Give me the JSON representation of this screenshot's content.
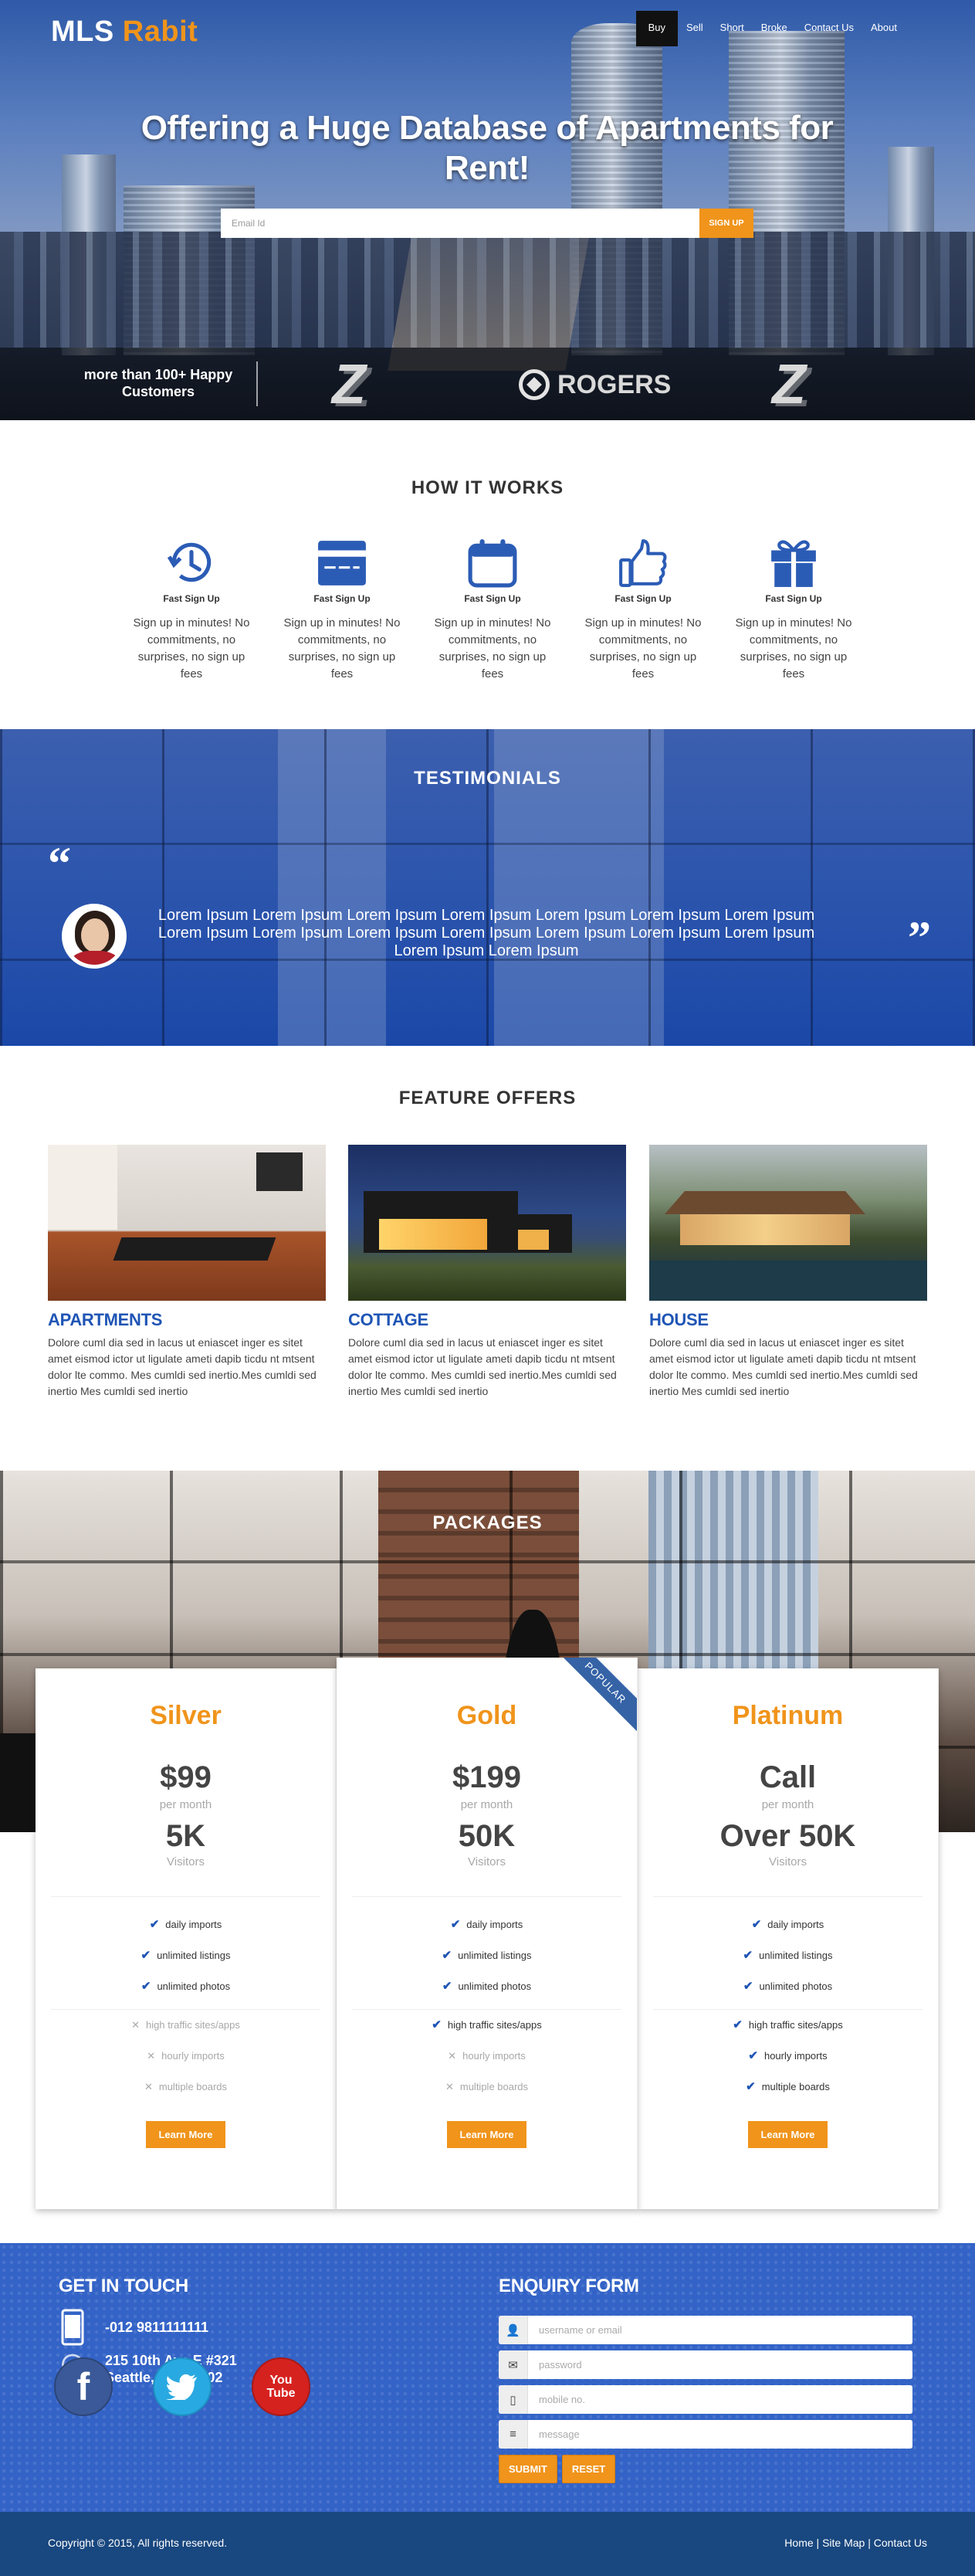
{
  "brand": {
    "part1": "MLS",
    "part2": "Rabit"
  },
  "nav": [
    {
      "label": "Buy",
      "active": true
    },
    {
      "label": "Sell"
    },
    {
      "label": "Short"
    },
    {
      "label": "Broke"
    },
    {
      "label": "Contact Us"
    },
    {
      "label": "About"
    }
  ],
  "hero": {
    "title": "Offering a Huge Database of Apartments for Rent!",
    "email_placeholder": "Email Id",
    "signup_label": "SIGN UP",
    "happy_customers": "more than 100+ Happy Customers",
    "client_logos": [
      "Z",
      "ROGERS",
      "Z"
    ]
  },
  "how_it_works": {
    "title": "HOW IT WORKS",
    "steps": [
      {
        "icon": "clock-icon",
        "title": "Fast Sign Up",
        "desc": "Sign up in minutes! No commitments, no surprises, no sign up fees"
      },
      {
        "icon": "credit-card-icon",
        "title": "Fast Sign Up",
        "desc": "Sign up in minutes! No commitments, no surprises, no sign up fees"
      },
      {
        "icon": "calendar-icon",
        "title": "Fast Sign Up",
        "desc": "Sign up in minutes! No commitments, no surprises, no sign up fees"
      },
      {
        "icon": "thumbs-up-icon",
        "title": "Fast Sign Up",
        "desc": "Sign up in minutes! No commitments, no surprises, no sign up fees"
      },
      {
        "icon": "gift-icon",
        "title": "Fast Sign Up",
        "desc": "Sign up in minutes! No commitments, no surprises, no sign up fees"
      }
    ]
  },
  "testimonials": {
    "title": "TESTIMONIALS",
    "text": "Lorem Ipsum Lorem Ipsum Lorem Ipsum Lorem Ipsum Lorem Ipsum Lorem Ipsum Lorem Ipsum Lorem Ipsum Lorem Ipsum Lorem Ipsum Lorem Ipsum Lorem Ipsum Lorem Ipsum Lorem Ipsum Lorem Ipsum Lorem Ipsum"
  },
  "feature_offers": {
    "title": "FEATURE OFFERS",
    "items": [
      {
        "title": "APARTMENTS",
        "desc": "Dolore cuml dia sed in lacus ut eniascet inger es sitet amet eismod ictor ut ligulate ameti dapib ticdu nt mtsent dolor lte commo. Mes cumldi sed inertio.Mes cumldi sed inertio Mes cumldi sed inertio"
      },
      {
        "title": "COTTAGE",
        "desc": "Dolore cuml dia sed in lacus ut eniascet inger es sitet amet eismod ictor ut ligulate ameti dapib ticdu nt mtsent dolor lte commo. Mes cumldi sed inertio.Mes cumldi sed inertio Mes cumldi sed inertio"
      },
      {
        "title": "HOUSE",
        "desc": "Dolore cuml dia sed in lacus ut eniascet inger es sitet amet eismod ictor ut ligulate ameti dapib ticdu nt mtsent dolor lte commo. Mes cumldi sed inertio.Mes cumldi sed inertio Mes cumldi sed inertio"
      }
    ]
  },
  "packages": {
    "title": "PACKAGES",
    "plans": [
      {
        "name": "Silver",
        "price": "$99",
        "per": "per month",
        "visitors": "5K",
        "visitors_label": "Visitors",
        "button": "Learn More",
        "features": [
          {
            "label": "daily imports",
            "included": true
          },
          {
            "label": "unlimited listings",
            "included": true
          },
          {
            "label": "unlimited photos",
            "included": true
          },
          {
            "label": "high traffic sites/apps",
            "included": false
          },
          {
            "label": "hourly imports",
            "included": false
          },
          {
            "label": "multiple boards",
            "included": false
          }
        ]
      },
      {
        "name": "Gold",
        "price": "$199",
        "per": "per month",
        "visitors": "50K",
        "visitors_label": "Visitors",
        "button": "Learn More",
        "ribbon": "POPULAR",
        "features": [
          {
            "label": "daily imports",
            "included": true
          },
          {
            "label": "unlimited listings",
            "included": true
          },
          {
            "label": "unlimited photos",
            "included": true
          },
          {
            "label": "high traffic sites/apps",
            "included": true
          },
          {
            "label": "hourly imports",
            "included": false
          },
          {
            "label": "multiple boards",
            "included": false
          }
        ]
      },
      {
        "name": "Platinum",
        "price": "Call",
        "per": "per month",
        "visitors": "Over 50K",
        "visitors_label": "Visitors",
        "button": "Learn More",
        "features": [
          {
            "label": "daily imports",
            "included": true
          },
          {
            "label": "unlimited listings",
            "included": true
          },
          {
            "label": "unlimited photos",
            "included": true
          },
          {
            "label": "high traffic sites/apps",
            "included": true
          },
          {
            "label": "hourly imports",
            "included": true
          },
          {
            "label": "multiple boards",
            "included": true
          }
        ]
      }
    ]
  },
  "contact": {
    "get_in_touch": "GET IN TOUCH",
    "phone": "-012 9811111111",
    "address_line1": "215 10th Ave E #321",
    "address_line2": "Seattle, WA 98102",
    "social": [
      {
        "name": "facebook-icon",
        "glyph": "f"
      },
      {
        "name": "twitter-icon",
        "glyph": "🐦"
      },
      {
        "name": "youtube-icon",
        "line1": "You",
        "line2": "Tube"
      }
    ],
    "enquiry_title": "ENQUIRY FORM",
    "fields": [
      {
        "icon": "user-icon",
        "glyph": "👤",
        "placeholder": "username or email"
      },
      {
        "icon": "email-icon",
        "glyph": "✉",
        "placeholder": "password"
      },
      {
        "icon": "mobile-icon",
        "glyph": "▯",
        "placeholder": "mobile no."
      },
      {
        "icon": "message-icon",
        "glyph": "≡",
        "placeholder": "message"
      }
    ],
    "submit_label": "SUBMIT",
    "reset_label": "RESET"
  },
  "footer": {
    "copyright": "Copyright © 2015, All rights reserved.",
    "links": [
      "Home",
      "Site Map",
      "Contact Us"
    ]
  }
}
